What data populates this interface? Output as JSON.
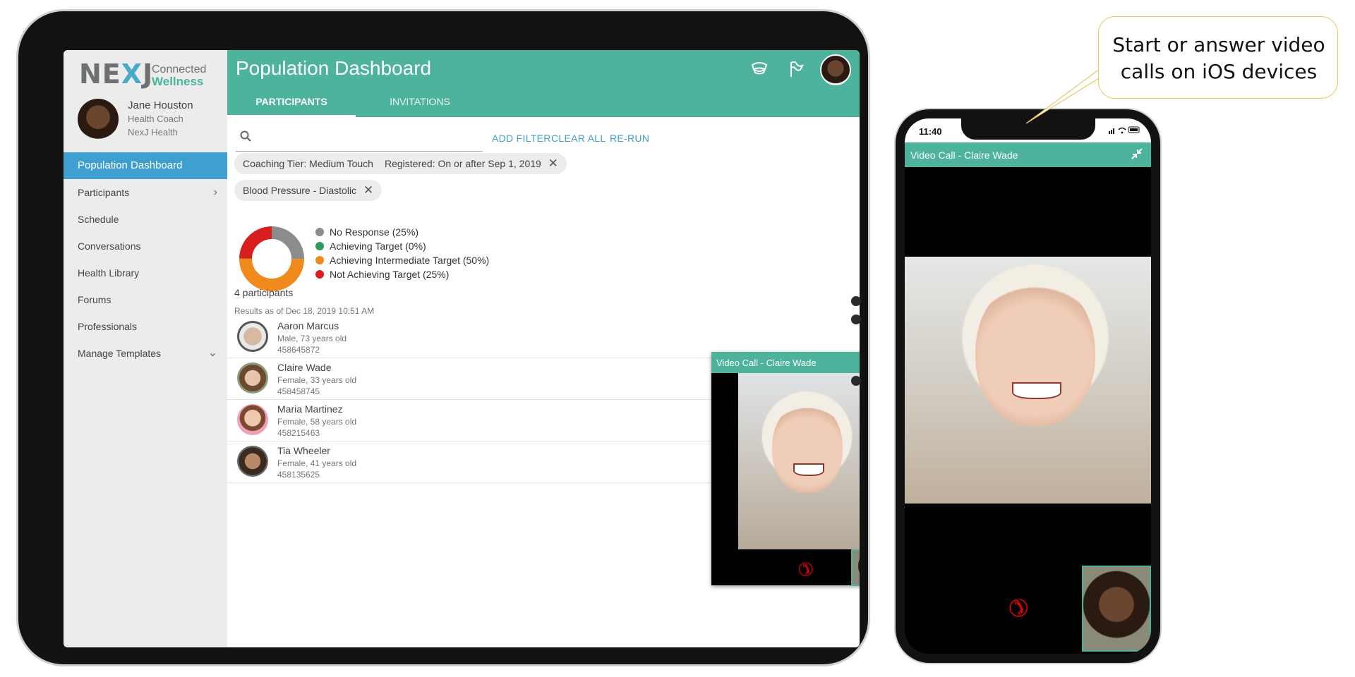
{
  "sidebar": {
    "logo": {
      "brand": "NEXJ",
      "line1": "Connected",
      "line2": "Wellness"
    },
    "profile": {
      "name": "Jane Houston",
      "role": "Health Coach",
      "org": "NexJ Health"
    },
    "items": [
      {
        "label": "Population Dashboard",
        "active": true
      },
      {
        "label": "Participants",
        "chevron": "›"
      },
      {
        "label": "Schedule"
      },
      {
        "label": "Conversations"
      },
      {
        "label": "Health Library"
      },
      {
        "label": "Forums"
      },
      {
        "label": "Professionals"
      },
      {
        "label": "Manage Templates",
        "chevron": "⌄"
      }
    ]
  },
  "header": {
    "title": "Population Dashboard",
    "tabs": [
      {
        "label": "PARTICIPANTS",
        "active": true
      },
      {
        "label": "INVITATIONS"
      }
    ],
    "icons": [
      "chat-bubbles-icon",
      "flag-icon",
      "user-avatar"
    ]
  },
  "toolbar": {
    "search_placeholder": "",
    "add_filter": "ADD FILTER",
    "clear_all": "CLEAR ALL",
    "rerun": "RE-RUN"
  },
  "filters": [
    "Coaching Tier: Medium Touch",
    "Registered: On or after Sep 1, 2019",
    "Blood Pressure - Diastolic"
  ],
  "chart_data": {
    "type": "pie",
    "donut": true,
    "categories": [
      "No Response (25%)",
      "Achieving Target (0%)",
      "Achieving Intermediate Target (50%)",
      "Not Achieving Target (25%)"
    ],
    "values": [
      25,
      0,
      50,
      25
    ],
    "colors": [
      "#8c8c8c",
      "#2e9a5e",
      "#f08a1c",
      "#d81e1e"
    ],
    "title": "",
    "legend": "right"
  },
  "results": {
    "count": "4 participants",
    "as_of": "Results as of Dec 18, 2019 10:51 AM",
    "participants": [
      {
        "name": "Aaron Marcus",
        "demo": "Male, 73 years old",
        "id": "458645872"
      },
      {
        "name": "Claire Wade",
        "demo": "Female, 33 years old",
        "id": "458458745"
      },
      {
        "name": "Maria Martinez",
        "demo": "Female, 58 years old",
        "id": "458215463"
      },
      {
        "name": "Tia Wheeler",
        "demo": "Female, 41 years old",
        "id": "458135625"
      }
    ]
  },
  "video_call": {
    "title": "Video Call - Claire Wade",
    "expand_icon": "expand-icon",
    "hangup_icon": "hang-up-icon"
  },
  "phone": {
    "time": "11:40",
    "title": "Video Call - Claire Wade",
    "collapse_icon": "collapse-icon"
  },
  "callout": {
    "line1": "Start or answer video",
    "line2": "calls on iOS devices"
  },
  "colors": {
    "accent": "#4db39c",
    "nav_active": "#3f9fd0",
    "link": "#3f9fd0",
    "hangup": "#e10000"
  }
}
